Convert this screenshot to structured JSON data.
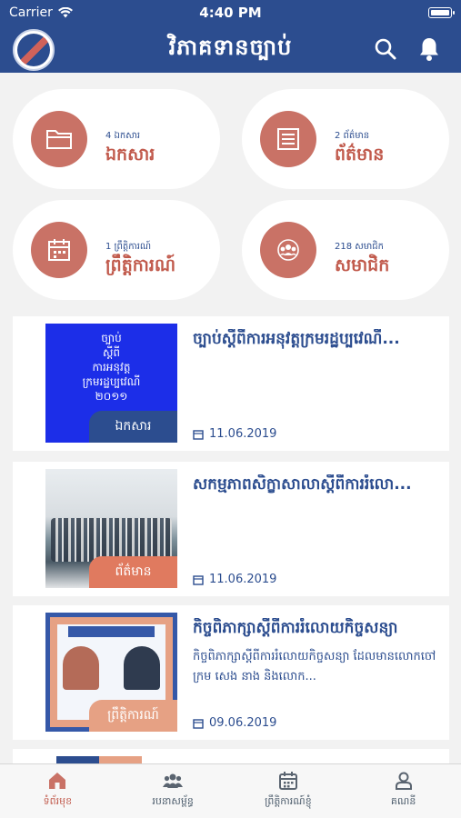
{
  "status_bar": {
    "carrier": "Carrier",
    "time": "4:40 PM"
  },
  "header": {
    "title": "វិភាគទានច្បាប់"
  },
  "categories": [
    {
      "count": "4 ឯកសារ",
      "label": "ឯកសារ",
      "icon": "folder-icon"
    },
    {
      "count": "2 ព័ត៌មាន",
      "label": "ព័ត៌មាន",
      "icon": "newspaper-icon"
    },
    {
      "count": "1 ព្រឹត្តិការណ៍",
      "label": "ព្រឹត្តិការណ៍",
      "icon": "calendar-icon"
    },
    {
      "count": "218 សមាជិក",
      "label": "សមាជិក",
      "icon": "group-icon"
    }
  ],
  "posts": [
    {
      "title": "ច្បាប់ស្តីពីការអនុវត្តក្រមរដ្ឋប្បវេណី...",
      "excerpt": "",
      "badge": "ឯកសារ",
      "date": "11.06.2019",
      "thumb_text": [
        "ច្បាប់",
        "ស្តីពី",
        "ការអនុវត្ត",
        "ក្រមរដ្ឋប្បវេណី",
        "២០១១"
      ]
    },
    {
      "title": "សកម្មភាពសិក្ខាសាលាស្តីពីការរំលោ...",
      "excerpt": "",
      "badge": "ព័ត៌មាន",
      "date": "11.06.2019"
    },
    {
      "title": "កិច្ចពិភាក្សាស្តីពីការរំលោយកិច្ចសន្យា",
      "excerpt": "កិច្ចពិភាក្សាស្តីពីការរំលោយកិច្ចសន្យា ដែលមានលោកចៅក្រម សេង នាង និងលោក...",
      "badge": "ព្រឹត្តិការណ៍",
      "date": "09.06.2019"
    }
  ],
  "tabs": [
    {
      "label": "ទំព័រមុខ",
      "icon": "home-icon",
      "active": true
    },
    {
      "label": "របនាសម្ព័ន្ធ",
      "icon": "people-icon",
      "active": false
    },
    {
      "label": "ព្រឹត្តិការណ៍ខ្ញុំ",
      "icon": "calendar-icon",
      "active": false
    },
    {
      "label": "គណនី",
      "icon": "user-icon",
      "active": false
    }
  ],
  "colors": {
    "primary": "#2c4d8f",
    "accent": "#c97266",
    "badge_doc": "#2c4d8f",
    "badge_news": "#e07a5f",
    "badge_event": "#e6a184"
  }
}
